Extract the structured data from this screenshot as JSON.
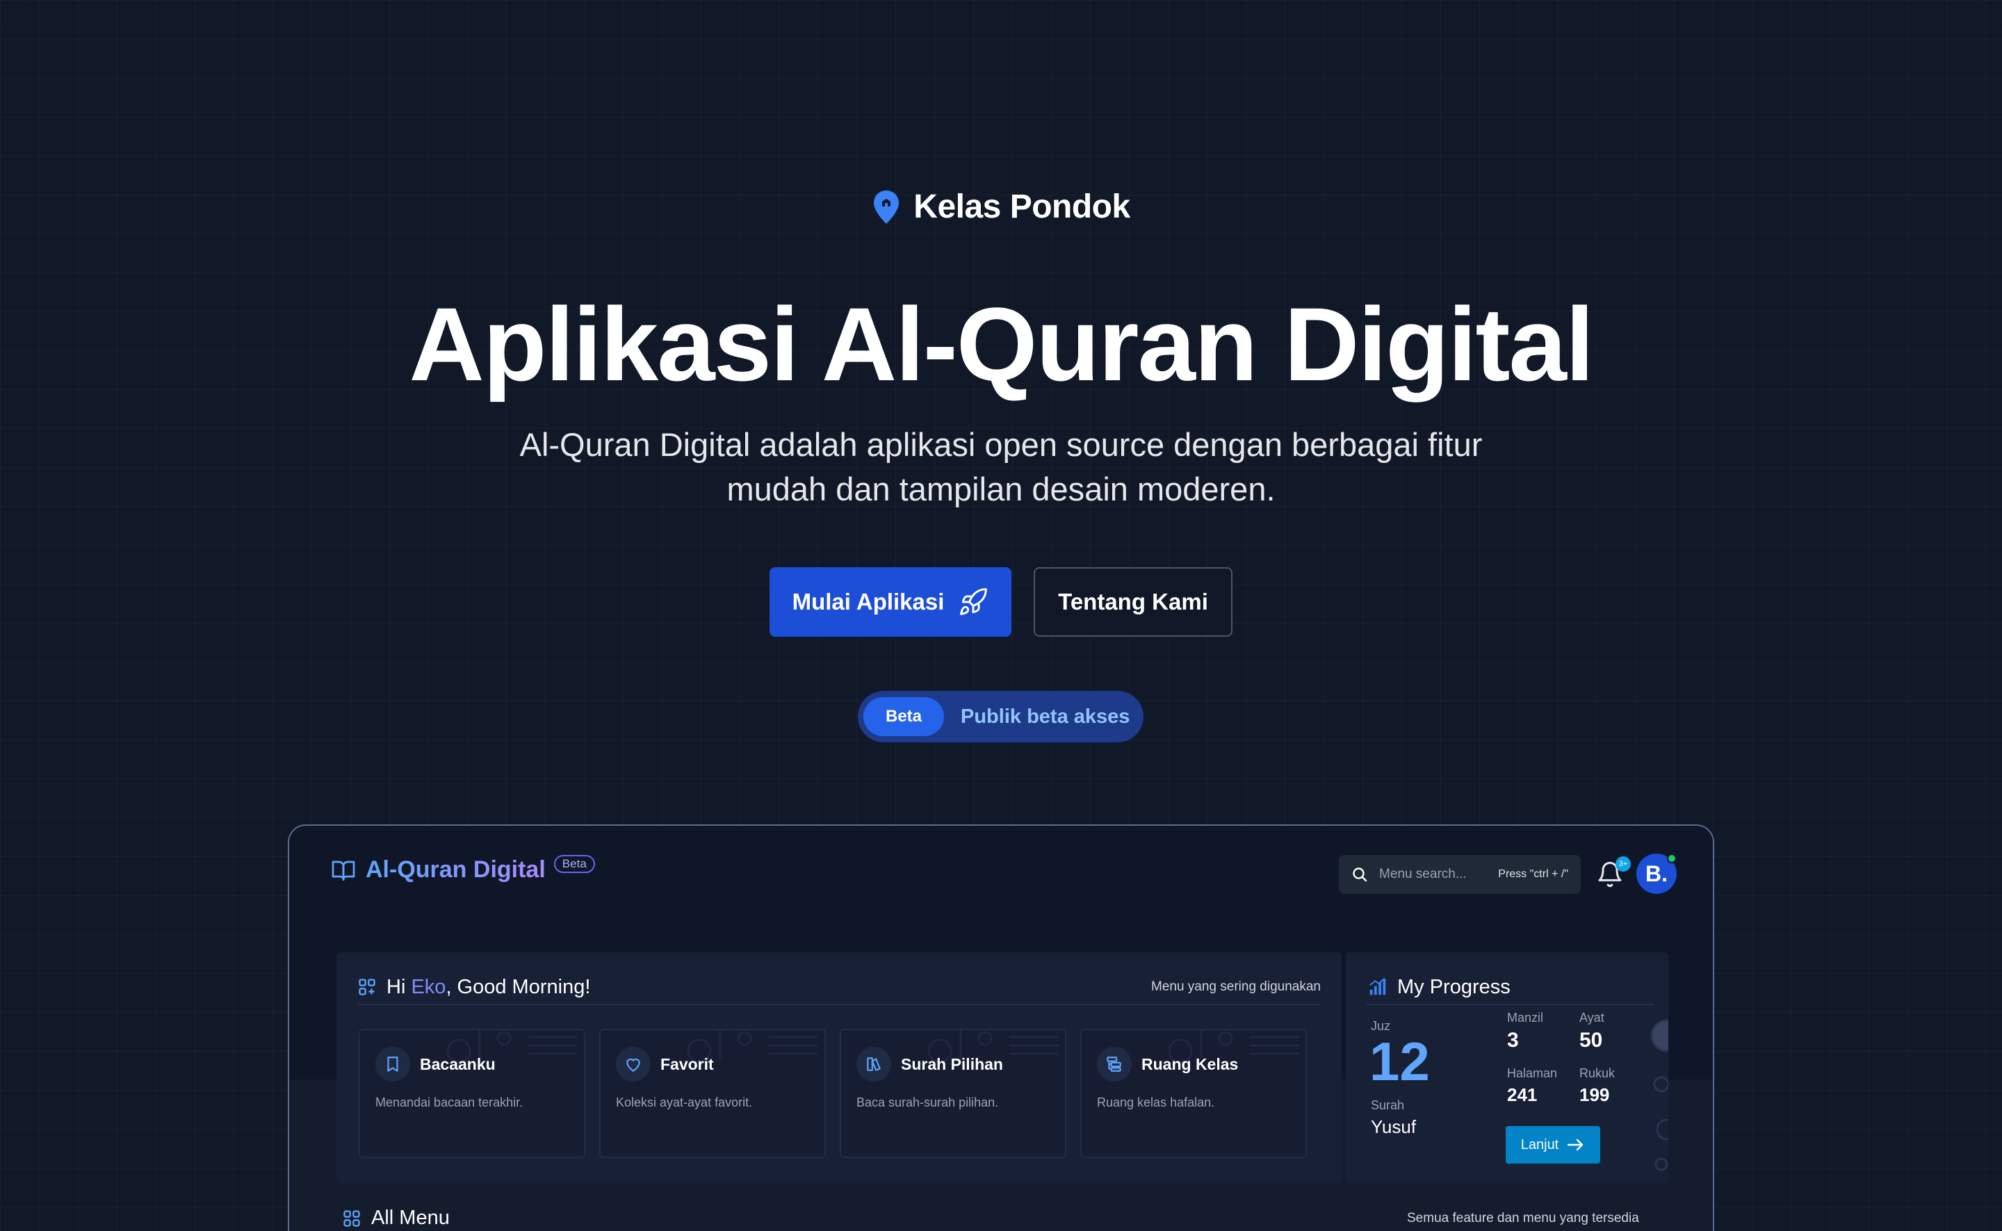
{
  "hero": {
    "brand": "Kelas Pondok",
    "title": "Aplikasi Al-Quran Digital",
    "subtitle_line1": "Al-Quran Digital adalah aplikasi open source dengan berbagai fitur",
    "subtitle_line2": "mudah dan tampilan desain moderen.",
    "primary_button": "Mulai Aplikasi",
    "secondary_button": "Tentang Kami",
    "beta_tag": "Beta",
    "beta_text": "Publik beta akses"
  },
  "app": {
    "logo": "Al-Quran Digital",
    "logo_badge": "Beta",
    "search_placeholder": "Menu search...",
    "search_hint": "Press \"ctrl + /\"",
    "notification_count": "3+",
    "avatar_letter": "B."
  },
  "greeting": {
    "prefix": "Hi ",
    "name": "Eko",
    "suffix": ", Good Morning!",
    "right": "Menu yang sering digunakan",
    "items": [
      {
        "label": "Bacaanku",
        "desc": "Menandai bacaan terakhir.",
        "icon": "bookmark-icon"
      },
      {
        "label": "Favorit",
        "desc": "Koleksi ayat-ayat favorit.",
        "icon": "heart-icon"
      },
      {
        "label": "Surah Pilihan",
        "desc": "Baca surah-surah pilihan.",
        "icon": "book-select-icon"
      },
      {
        "label": "Ruang Kelas",
        "desc": "Ruang kelas hafalan.",
        "icon": "classroom-icon"
      }
    ]
  },
  "progress": {
    "title": "My Progress",
    "juz_label": "Juz",
    "juz_value": "12",
    "surah_label": "Surah",
    "surah_value": "Yusuf",
    "manzil_label": "Manzil",
    "manzil_value": "3",
    "ayat_label": "Ayat",
    "ayat_value": "50",
    "halaman_label": "Halaman",
    "halaman_value": "241",
    "rukuk_label": "Rukuk",
    "rukuk_value": "199",
    "button": "Lanjut"
  },
  "all_menu": {
    "title": "All Menu",
    "right": "Semua feature dan menu yang tersedia"
  },
  "colors": {
    "background": "#111827",
    "primary": "#1d4ed8",
    "accent": "#60a5fa"
  }
}
